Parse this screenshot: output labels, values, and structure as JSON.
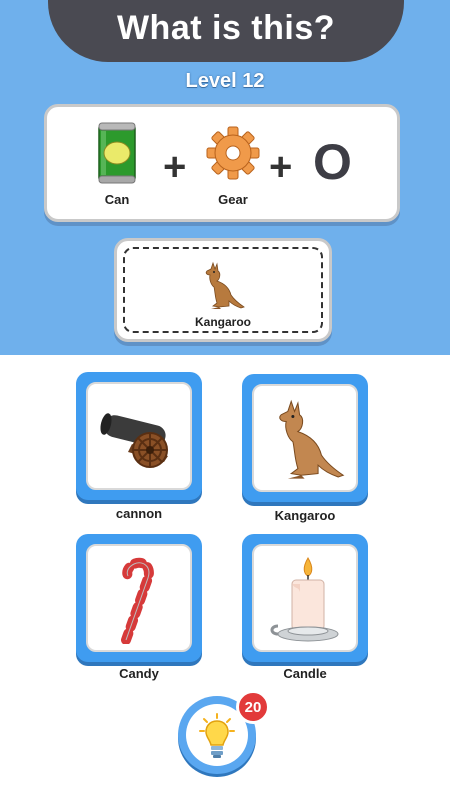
{
  "header": {
    "title": "What is this?"
  },
  "level": {
    "label": "Level 12"
  },
  "equation": {
    "items": [
      {
        "label": "Can",
        "icon": "can-icon"
      },
      {
        "label": "Gear",
        "icon": "gear-icon"
      }
    ],
    "plus_symbol": "+",
    "letter": "O"
  },
  "answer": {
    "label": "Kangaroo",
    "icon": "kangaroo-icon"
  },
  "options": [
    {
      "label": "cannon",
      "icon": "cannon-icon"
    },
    {
      "label": "Kangaroo",
      "icon": "kangaroo-icon"
    },
    {
      "label": "Candy",
      "icon": "candy-cane-icon"
    },
    {
      "label": "Candle",
      "icon": "candle-icon"
    }
  ],
  "hint": {
    "count": "20",
    "icon": "lightbulb-icon"
  },
  "colors": {
    "sky": "#6fb0ec",
    "banner": "#4a4a52",
    "option_blue": "#3f9cf0",
    "badge": "#e23a3a"
  }
}
